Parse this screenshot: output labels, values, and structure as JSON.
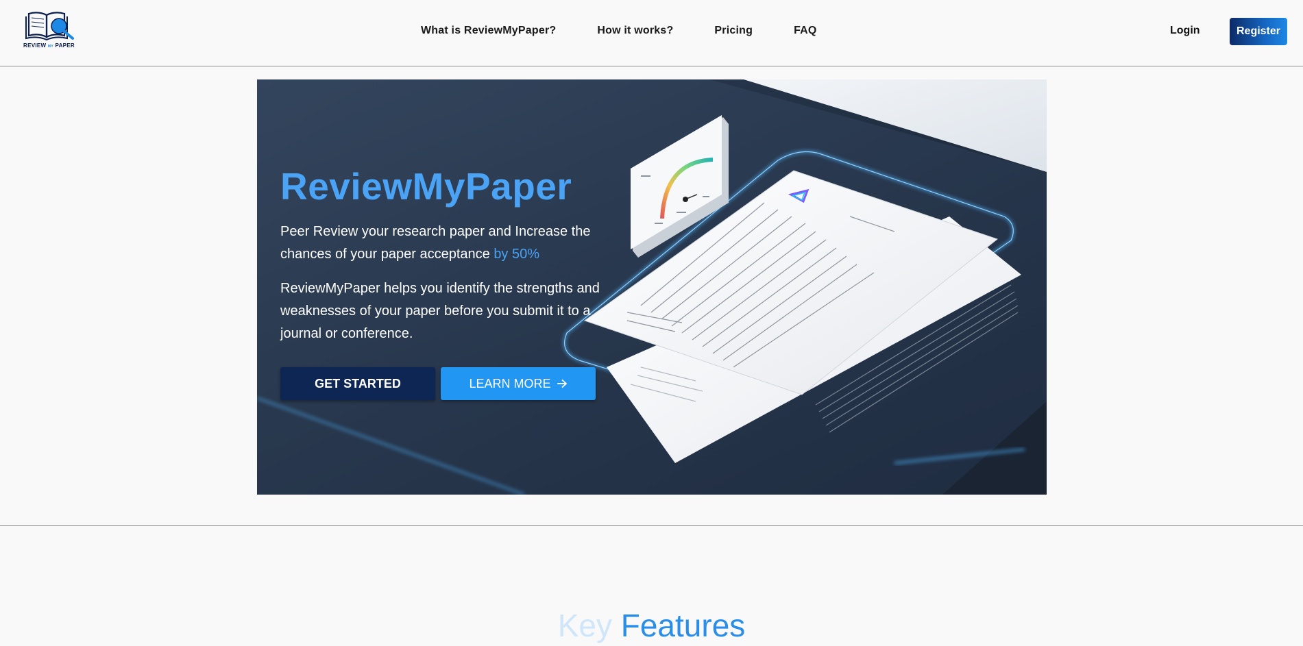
{
  "brand": {
    "logo_word_review": "REVIEW",
    "logo_word_my": "MY",
    "logo_word_paper": "PAPER"
  },
  "nav": {
    "items": [
      {
        "label": "What is ReviewMyPaper?"
      },
      {
        "label": "How it works?"
      },
      {
        "label": "Pricing"
      },
      {
        "label": "FAQ"
      }
    ],
    "login_label": "Login",
    "register_label": "Register"
  },
  "hero": {
    "title": "ReviewMyPaper",
    "subtitle_main": "Peer Review your research paper and Increase the chances of your paper acceptance ",
    "subtitle_highlight": "by 50%",
    "description": "ReviewMyPaper helps you identify the strengths and weaknesses of your paper before you submit it to a journal or conference.",
    "get_started_label": "GET STARTED",
    "learn_more_label": "LEARN MORE",
    "learn_more_icon": "arrow-right-icon"
  },
  "features": {
    "title_faded": "Key",
    "title_rest": " Features"
  },
  "colors": {
    "accent": "#4aa3f5",
    "primary_dark": "#0d2654",
    "primary_button": "#2196f3",
    "hero_background": "#1e2b3d"
  }
}
